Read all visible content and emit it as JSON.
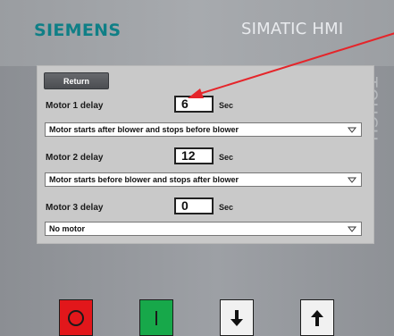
{
  "header": {
    "brand": "SIEMENS",
    "model": "SIMATIC HMI",
    "touch_label": "TOUCH"
  },
  "screen": {
    "return_label": "Return",
    "rows": [
      {
        "label": "Motor 1 delay",
        "value": "6",
        "unit": "Sec",
        "mode": "Motor starts after blower and stops before blower"
      },
      {
        "label": "Motor 2 delay",
        "value": "12",
        "unit": "Sec",
        "mode": "Motor starts before blower and stops after blower"
      },
      {
        "label": "Motor 3 delay",
        "value": "0",
        "unit": "Sec",
        "mode": "No motor"
      }
    ]
  },
  "colors": {
    "brand_teal": "#0f7f86",
    "stop_red": "#e2171b",
    "start_green": "#17a84a",
    "annotation_red": "#e5252a"
  },
  "keys": [
    {
      "name": "stop-key",
      "icon": "circle-icon"
    },
    {
      "name": "start-key",
      "icon": "bar-icon"
    },
    {
      "name": "down-key",
      "icon": "arrow-down-icon"
    },
    {
      "name": "up-key",
      "icon": "arrow-up-icon"
    }
  ]
}
